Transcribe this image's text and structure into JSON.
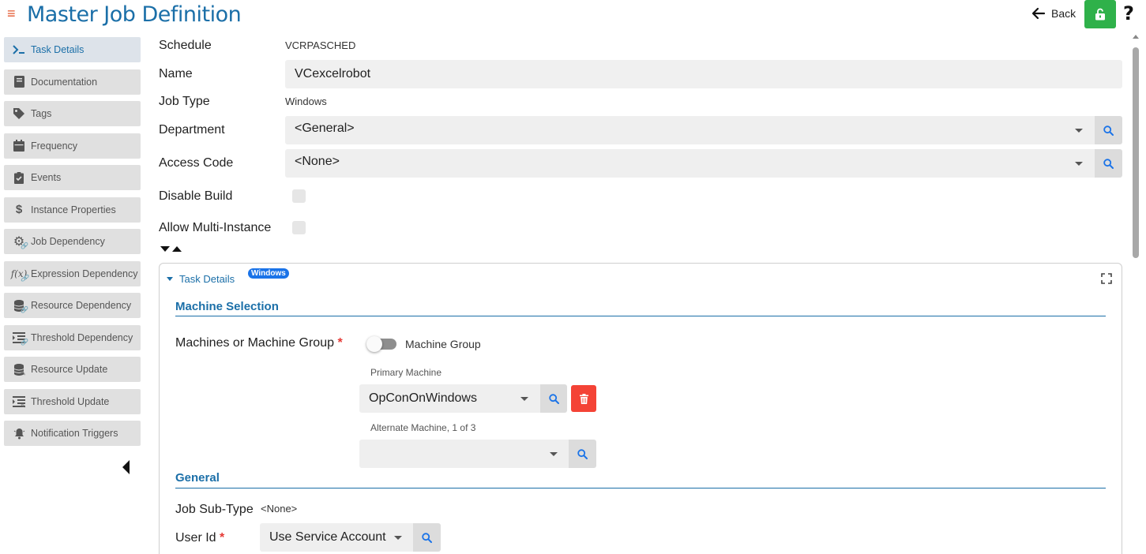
{
  "header": {
    "title": "Master Job Definition",
    "back_label": "Back",
    "help_label": "?"
  },
  "sidebar": {
    "items": [
      {
        "label": "Task Details",
        "icon": "terminal-icon",
        "active": true
      },
      {
        "label": "Documentation",
        "icon": "book-icon"
      },
      {
        "label": "Tags",
        "icon": "tag-icon"
      },
      {
        "label": "Frequency",
        "icon": "calendar-icon"
      },
      {
        "label": "Events",
        "icon": "clipboard-check-icon"
      },
      {
        "label": "Instance Properties",
        "icon": "dollar-icon"
      },
      {
        "label": "Job Dependency",
        "icon": "gear-link-icon"
      },
      {
        "label": "Expression Dependency",
        "icon": "function-link-icon"
      },
      {
        "label": "Resource Dependency",
        "icon": "database-link-icon"
      },
      {
        "label": "Threshold Dependency",
        "icon": "threshold-link-icon"
      },
      {
        "label": "Resource Update",
        "icon": "database-edit-icon"
      },
      {
        "label": "Threshold Update",
        "icon": "threshold-edit-icon"
      },
      {
        "label": "Notification Triggers",
        "icon": "bell-icon"
      }
    ]
  },
  "form": {
    "schedule_label": "Schedule",
    "schedule_value": "VCRPASCHED",
    "name_label": "Name",
    "name_value": "VCexcelrobot",
    "job_type_label": "Job Type",
    "job_type_value": "Windows",
    "department_label": "Department",
    "department_value": "<General>",
    "access_code_label": "Access Code",
    "access_code_value": "<None>",
    "disable_build_label": "Disable Build",
    "disable_build_checked": false,
    "allow_multi_label": "Allow Multi-Instance",
    "allow_multi_checked": false
  },
  "panel": {
    "title": "Task Details",
    "badge": "Windows",
    "machine_section_title": "Machine Selection",
    "machines_label": "Machines or Machine Group",
    "required_mark": "*",
    "toggle_label": "Machine Group",
    "toggle_on": false,
    "primary_machine_label": "Primary Machine",
    "primary_machine_value": "OpConOnWindows",
    "alternate_machine_label": "Alternate Machine, 1 of 3",
    "alternate_machine_value": "",
    "general_section_title": "General",
    "job_subtype_label": "Job Sub-Type",
    "job_subtype_value": "<None>",
    "user_id_label": "User Id",
    "user_id_value": "Use Service Account"
  },
  "colors": {
    "accent": "#1b6fa8",
    "lock_green": "#2fb14a",
    "delete_red": "#f44336",
    "badge_blue": "#1a73e8",
    "hamburger": "#e4572e"
  }
}
